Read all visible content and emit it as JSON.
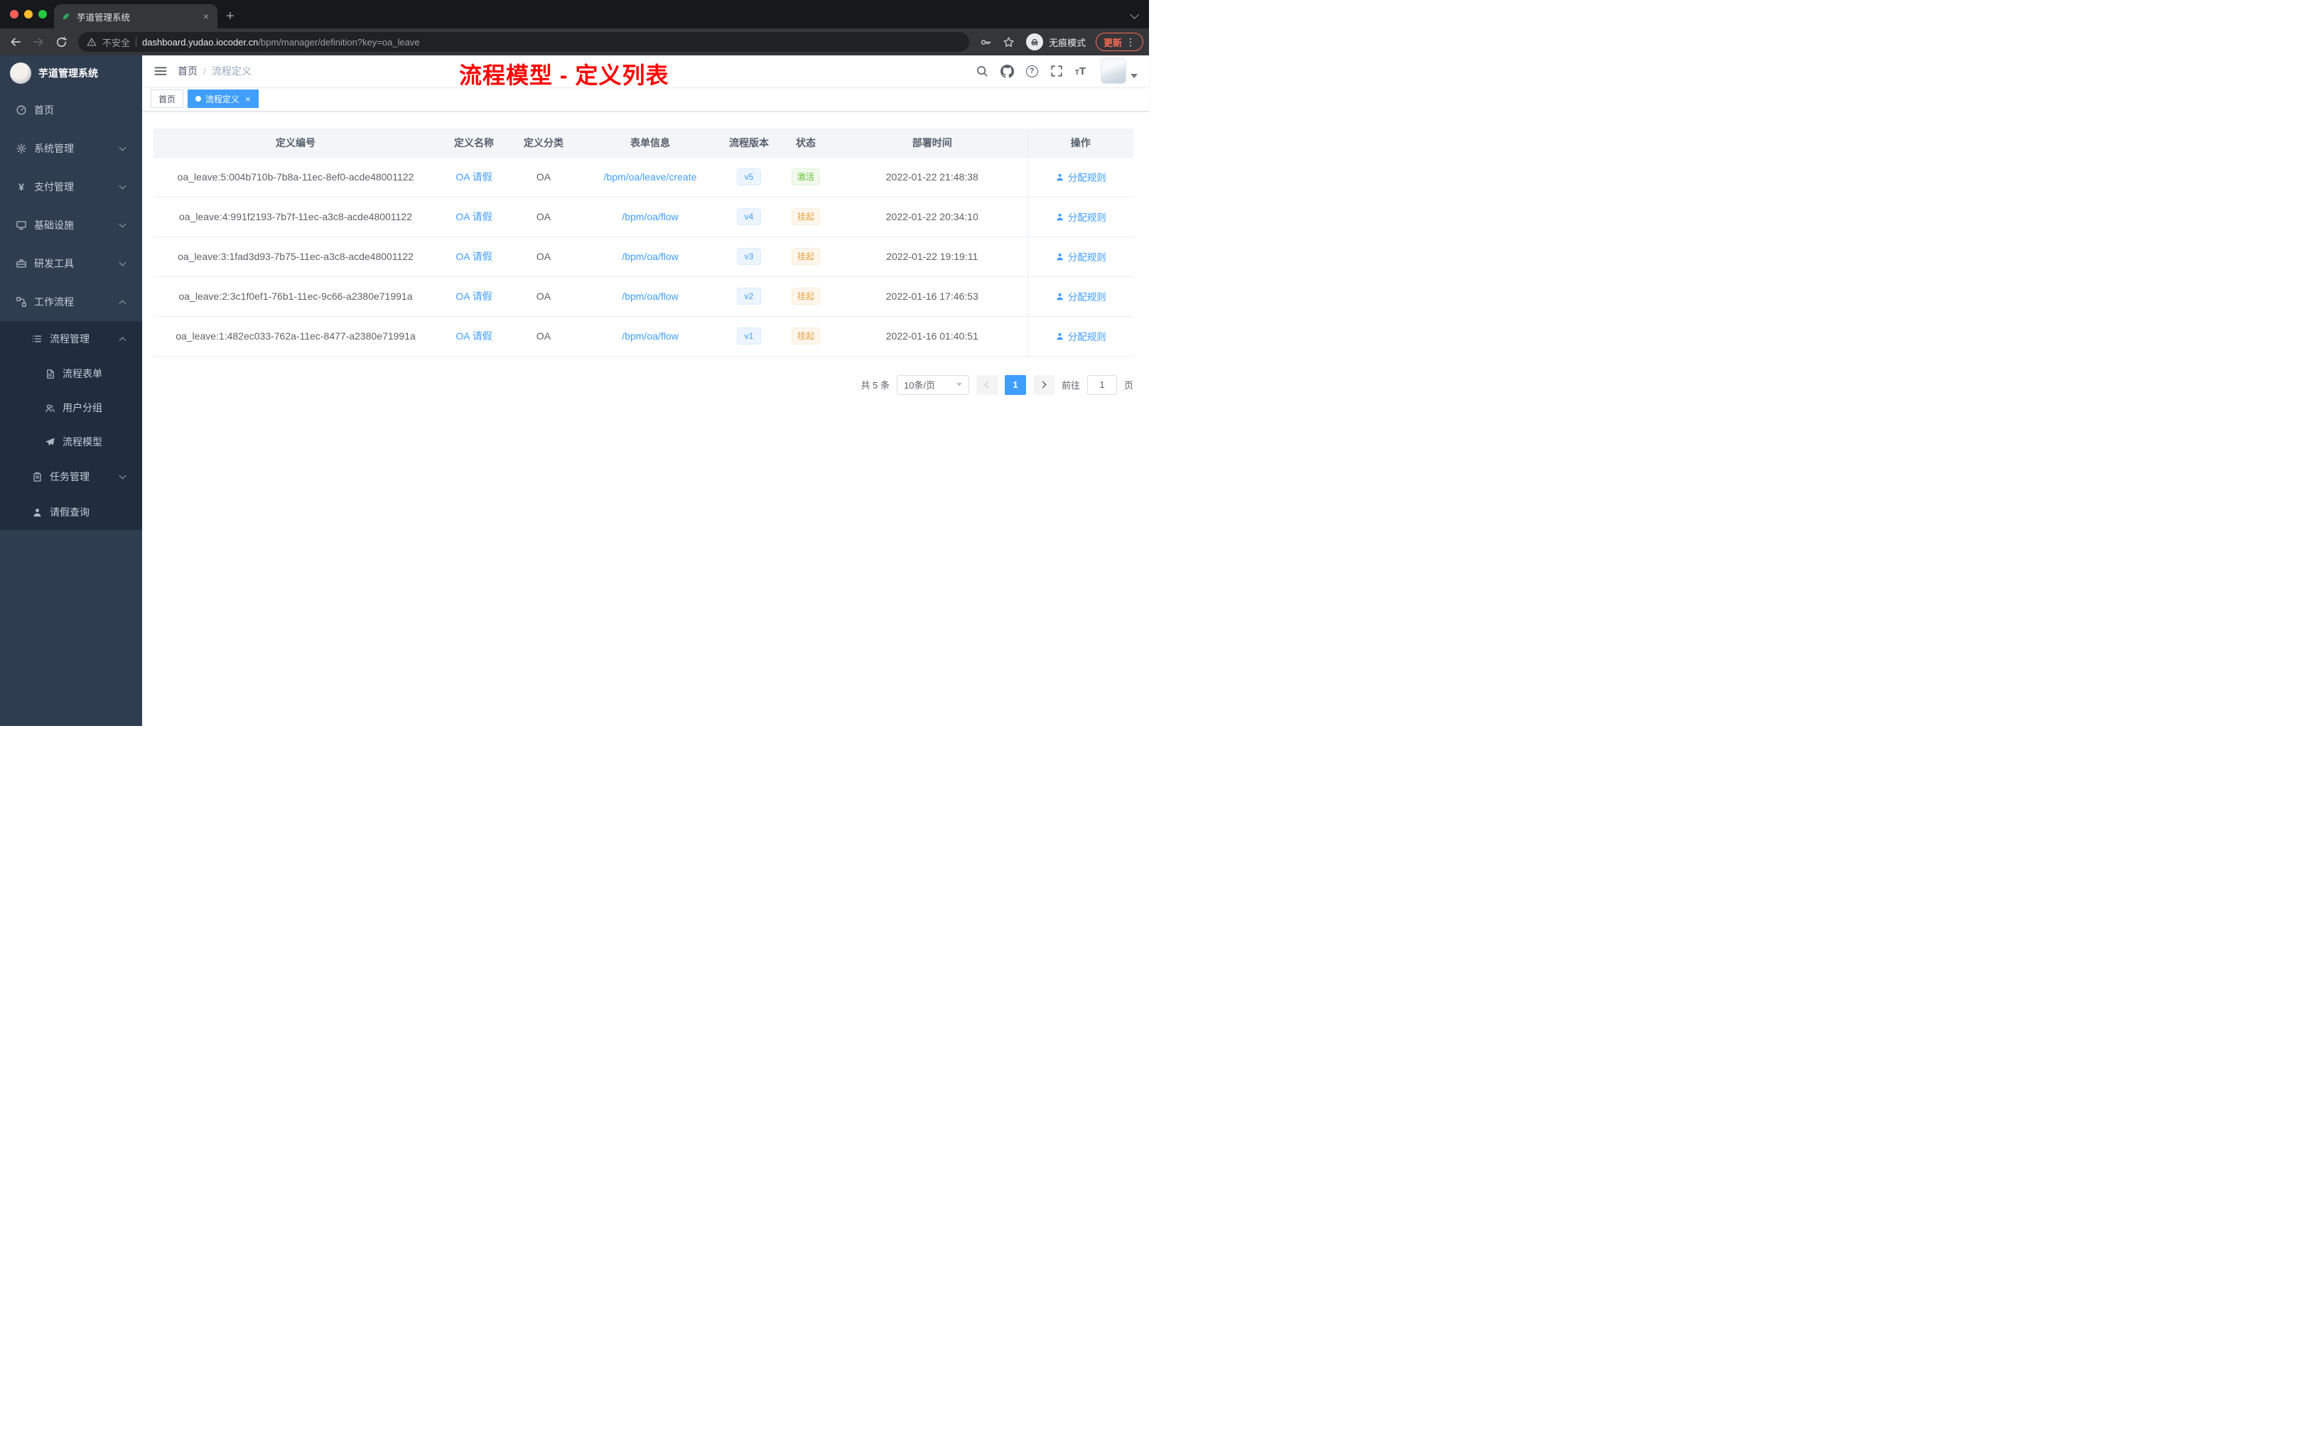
{
  "browser": {
    "tab_title": "芋道管理系统",
    "security_label": "不安全",
    "url_host": "dashboard.yudao.iocoder.cn",
    "url_path": "/bpm/manager/definition?key=oa_leave",
    "incognito_label": "无痕模式",
    "update_label": "更新"
  },
  "sidebar": {
    "logo_title": "芋道管理系统",
    "items": [
      {
        "label": "首页"
      },
      {
        "label": "系统管理"
      },
      {
        "label": "支付管理"
      },
      {
        "label": "基础设施"
      },
      {
        "label": "研发工具"
      },
      {
        "label": "工作流程"
      },
      {
        "label": "流程管理"
      },
      {
        "label": "流程表单"
      },
      {
        "label": "用户分组"
      },
      {
        "label": "流程模型"
      },
      {
        "label": "任务管理"
      },
      {
        "label": "请假查询"
      }
    ]
  },
  "header": {
    "breadcrumb_home": "首页",
    "breadcrumb_current": "流程定义",
    "annotation": "流程模型 - 定义列表"
  },
  "tags": {
    "home": "首页",
    "active": "流程定义"
  },
  "table": {
    "columns": [
      "定义编号",
      "定义名称",
      "定义分类",
      "表单信息",
      "流程版本",
      "状态",
      "部署时间",
      "操作"
    ],
    "rows": [
      {
        "id": "oa_leave:5:004b710b-7b8a-11ec-8ef0-acde48001122",
        "name": "OA 请假",
        "category": "OA",
        "form": "/bpm/oa/leave/create",
        "version": "v5",
        "status": "激活",
        "status_type": "success",
        "deployed": "2022-01-22 21:48:38",
        "action": "分配规则"
      },
      {
        "id": "oa_leave:4:991f2193-7b7f-11ec-a3c8-acde48001122",
        "name": "OA 请假",
        "category": "OA",
        "form": "/bpm/oa/flow",
        "version": "v4",
        "status": "挂起",
        "status_type": "warning",
        "deployed": "2022-01-22 20:34:10",
        "action": "分配规则"
      },
      {
        "id": "oa_leave:3:1fad3d93-7b75-11ec-a3c8-acde48001122",
        "name": "OA 请假",
        "category": "OA",
        "form": "/bpm/oa/flow",
        "version": "v3",
        "status": "挂起",
        "status_type": "warning",
        "deployed": "2022-01-22 19:19:11",
        "action": "分配规则"
      },
      {
        "id": "oa_leave:2:3c1f0ef1-76b1-11ec-9c66-a2380e71991a",
        "name": "OA 请假",
        "category": "OA",
        "form": "/bpm/oa/flow",
        "version": "v2",
        "status": "挂起",
        "status_type": "warning",
        "deployed": "2022-01-16 17:46:53",
        "action": "分配规则"
      },
      {
        "id": "oa_leave:1:482ec033-762a-11ec-8477-a2380e71991a",
        "name": "OA 请假",
        "category": "OA",
        "form": "/bpm/oa/flow",
        "version": "v1",
        "status": "挂起",
        "status_type": "warning",
        "deployed": "2022-01-16 01:40:51",
        "action": "分配规则"
      }
    ]
  },
  "pagination": {
    "total": "共 5 条",
    "page_size": "10条/页",
    "current": "1",
    "goto_label": "前往",
    "goto_value": "1",
    "goto_unit": "页"
  },
  "colors": {
    "accent": "#409eff",
    "annotation_red": "#ff0000",
    "status_active": "#67c23a",
    "status_suspended": "#e6a23c",
    "sidebar_bg": "#2f3d50",
    "sidebar_sub_bg": "#1f2d3d"
  }
}
